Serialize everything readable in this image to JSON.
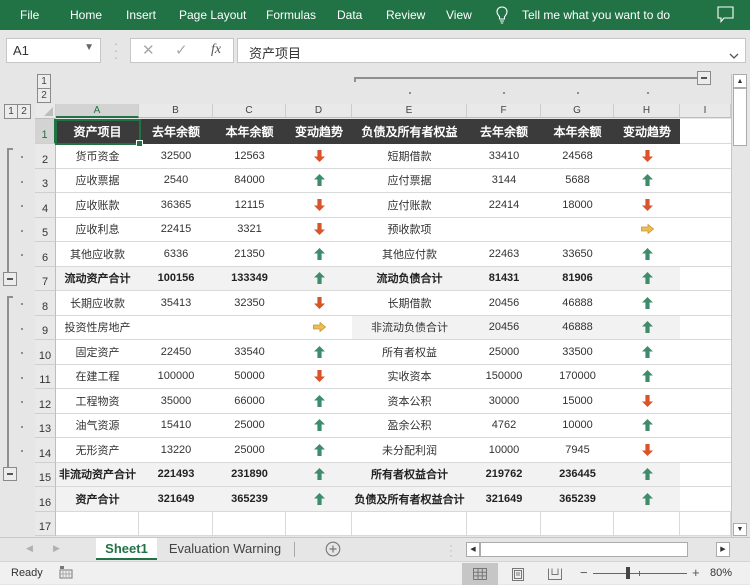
{
  "ribbon": {
    "tabs": [
      "File",
      "Home",
      "Insert",
      "Page Layout",
      "Formulas",
      "Data",
      "Review",
      "View"
    ],
    "tell_me": "Tell me what you want to do"
  },
  "formula_bar": {
    "name_box": "A1",
    "function_label": "fx",
    "formula": "资产项目"
  },
  "outline": {
    "row_level_buttons": [
      "1",
      "2"
    ],
    "column_level_buttons": [
      "1",
      "2"
    ]
  },
  "column_headers": [
    "A",
    "B",
    "C",
    "D",
    "E",
    "F",
    "G",
    "H",
    "I"
  ],
  "selected_cell": "A1",
  "grid": {
    "rows": [
      {
        "num": "1",
        "type": "header",
        "cells": [
          "资产项目",
          "去年余额",
          "本年余额",
          "变动趋势",
          "负债及所有者权益",
          "去年余额",
          "本年余额",
          "变动趋势"
        ]
      },
      {
        "num": "2",
        "type": "normal",
        "cells": [
          "货币资金",
          "32500",
          "12563",
          "down",
          "短期借款",
          "33410",
          "24568",
          "down"
        ]
      },
      {
        "num": "3",
        "type": "normal",
        "cells": [
          "应收票据",
          "2540",
          "84000",
          "up",
          "应付票据",
          "3144",
          "5688",
          "up"
        ]
      },
      {
        "num": "4",
        "type": "normal",
        "cells": [
          "应收账款",
          "36365",
          "12115",
          "down",
          "应付账款",
          "22414",
          "18000",
          "down"
        ]
      },
      {
        "num": "5",
        "type": "normal",
        "cells": [
          "应收利息",
          "22415",
          "3321",
          "down",
          "预收款项",
          "",
          "",
          "right"
        ]
      },
      {
        "num": "6",
        "type": "normal",
        "cells": [
          "其他应收款",
          "6336",
          "21350",
          "up",
          "其他应付款",
          "22463",
          "33650",
          "up"
        ]
      },
      {
        "num": "7",
        "type": "total",
        "cells": [
          "流动资产合计",
          "100156",
          "133349",
          "up",
          "流动负债合计",
          "81431",
          "81906",
          "up"
        ]
      },
      {
        "num": "8",
        "type": "normal",
        "cells": [
          "长期应收款",
          "35413",
          "32350",
          "down",
          "长期借款",
          "20456",
          "46888",
          "up"
        ]
      },
      {
        "num": "9",
        "type": "normal",
        "shade_right": true,
        "cells": [
          "投资性房地产",
          "",
          "",
          "right",
          "非流动负债合计",
          "20456",
          "46888",
          "up"
        ]
      },
      {
        "num": "10",
        "type": "normal",
        "cells": [
          "固定资产",
          "22450",
          "33540",
          "up",
          "所有者权益",
          "25000",
          "33500",
          "up"
        ]
      },
      {
        "num": "11",
        "type": "normal",
        "cells": [
          "在建工程",
          "100000",
          "50000",
          "down",
          "实收资本",
          "150000",
          "170000",
          "up"
        ]
      },
      {
        "num": "12",
        "type": "normal",
        "cells": [
          "工程物资",
          "35000",
          "66000",
          "up",
          "资本公积",
          "30000",
          "15000",
          "down"
        ]
      },
      {
        "num": "13",
        "type": "normal",
        "cells": [
          "油气资源",
          "15410",
          "25000",
          "up",
          "盈余公积",
          "4762",
          "10000",
          "up"
        ]
      },
      {
        "num": "14",
        "type": "normal",
        "cells": [
          "无形资产",
          "13220",
          "25000",
          "up",
          "未分配利润",
          "10000",
          "7945",
          "down"
        ]
      },
      {
        "num": "15",
        "type": "total",
        "cells": [
          "非流动资产合计",
          "221493",
          "231890",
          "up",
          "所有者权益合计",
          "219762",
          "236445",
          "up"
        ]
      },
      {
        "num": "16",
        "type": "total",
        "cells": [
          "资产合计",
          "321649",
          "365239",
          "up",
          "负债及所有者权益合计",
          "321649",
          "365239",
          "up"
        ]
      },
      {
        "num": "17",
        "type": "empty",
        "cells": []
      }
    ]
  },
  "sheet_tabs": {
    "tabs": [
      "Sheet1",
      "Evaluation Warning"
    ],
    "active": "Sheet1"
  },
  "status_bar": {
    "status": "Ready",
    "zoom_label": "80%",
    "zoom_percent": 80
  },
  "colors": {
    "accent": "#217346",
    "header_bg": "#3b3b3b",
    "total_bg": "#f2f2f2",
    "trend_up": "#3f8c6c",
    "trend_down": "#d9532b",
    "trend_neutral": "#ecbc56"
  }
}
